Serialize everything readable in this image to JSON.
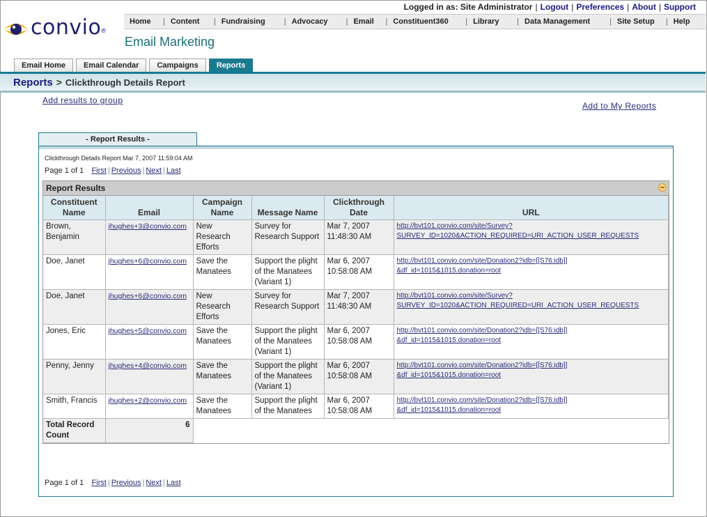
{
  "logo": {
    "text": "convio",
    "tm": "®"
  },
  "utility": {
    "logged_in": "Logged in as: Site Administrator",
    "links": [
      "Logout",
      "Preferences",
      "About",
      "Support"
    ]
  },
  "topnav": [
    "Home",
    "Content",
    "Fundraising",
    "Advocacy",
    "Email",
    "Constituent360",
    "Library",
    "Data Management",
    "Site Setup",
    "Help"
  ],
  "section_title": "Email Marketing",
  "tabs": [
    {
      "label": "Email Home",
      "active": false
    },
    {
      "label": "Email Calendar",
      "active": false
    },
    {
      "label": "Campaigns",
      "active": false
    },
    {
      "label": "Reports",
      "active": true
    }
  ],
  "breadcrumb": {
    "root": "Reports",
    "arrow": ">",
    "current": "Clickthrough Details Report"
  },
  "actions": {
    "add_group": "Add results to group",
    "add_reports": "Add to My Reports"
  },
  "report": {
    "tab_label": "- Report Results -",
    "caption": "Clickthrough Details Report Mar 7, 2007 11:59:04 AM",
    "pager": {
      "page_text": "Page 1 of 1",
      "first": "First",
      "previous": "Previous",
      "next": "Next",
      "last": "Last"
    },
    "grid_title": "Report Results",
    "columns": [
      "Constituent Name",
      "Email",
      "Campaign Name",
      "Message Name",
      "Clickthrough Date",
      "URL"
    ],
    "rows": [
      {
        "name": "Brown, Benjamin",
        "email": "jhughes+3@convio.com",
        "campaign": "New Research Efforts",
        "message": "Survey for Research Support",
        "date": "Mar 7, 2007 11:48:30 AM",
        "url1": "http://bvt101.convio.com/site/Survey?",
        "url2": "SURVEY_ID=1020&ACTION_REQUIRED=URI_ACTION_USER_REQUESTS"
      },
      {
        "name": "Doe, Janet",
        "email": "jhughes+6@convio.com",
        "campaign": "Save the Manatees",
        "message": "Support the plight of the Manatees (Variant 1)",
        "date": "Mar 6, 2007 10:58:08 AM",
        "url1": "http://bvt101.convio.com/site/Donation2?idb=[[S76:idb]]",
        "url2": "&df_id=1015&1015.donation=root"
      },
      {
        "name": "Doe, Janet",
        "email": "jhughes+6@convio.com",
        "campaign": "New Research Efforts",
        "message": "Survey for Research Support",
        "date": "Mar 7, 2007 11:48:30 AM",
        "url1": "http://bvt101.convio.com/site/Survey?",
        "url2": "SURVEY_ID=1020&ACTION_REQUIRED=URI_ACTION_USER_REQUESTS"
      },
      {
        "name": "Jones, Eric",
        "email": "jhughes+5@convio.com",
        "campaign": "Save the Manatees",
        "message": "Support the plight of the Manatees (Variant 1)",
        "date": "Mar 6, 2007 10:58:08 AM",
        "url1": "http://bvt101.convio.com/site/Donation2?idb=[[S76:idb]]",
        "url2": "&df_id=1015&1015.donation=root"
      },
      {
        "name": "Penny, Jenny",
        "email": "jhughes+4@convio.com",
        "campaign": "Save the Manatees",
        "message": "Support the plight of the Manatees (Variant 1)",
        "date": "Mar 6, 2007 10:58:08 AM",
        "url1": "http://bvt101.convio.com/site/Donation2?idb=[[S76:idb]]",
        "url2": "&df_id=1015&1015.donation=root"
      },
      {
        "name": "Smith, Francis",
        "email": "jhughes+2@convio.com",
        "campaign": "Save the Manatees",
        "message": "Support the plight of the Manatees",
        "date": "Mar 6, 2007 10:58:08 AM",
        "url1": "http://bvt101.convio.com/site/Donation2?idb=[[S76:idb]]",
        "url2": "&df_id=1015&1015.donation=root"
      }
    ],
    "total_label": "Total Record Count",
    "total_value": "6"
  },
  "colors": {
    "accent": "#1a7a90",
    "brand_navy": "#20206a",
    "brand_gold": "#f0a818",
    "link": "#2a2a7a"
  }
}
